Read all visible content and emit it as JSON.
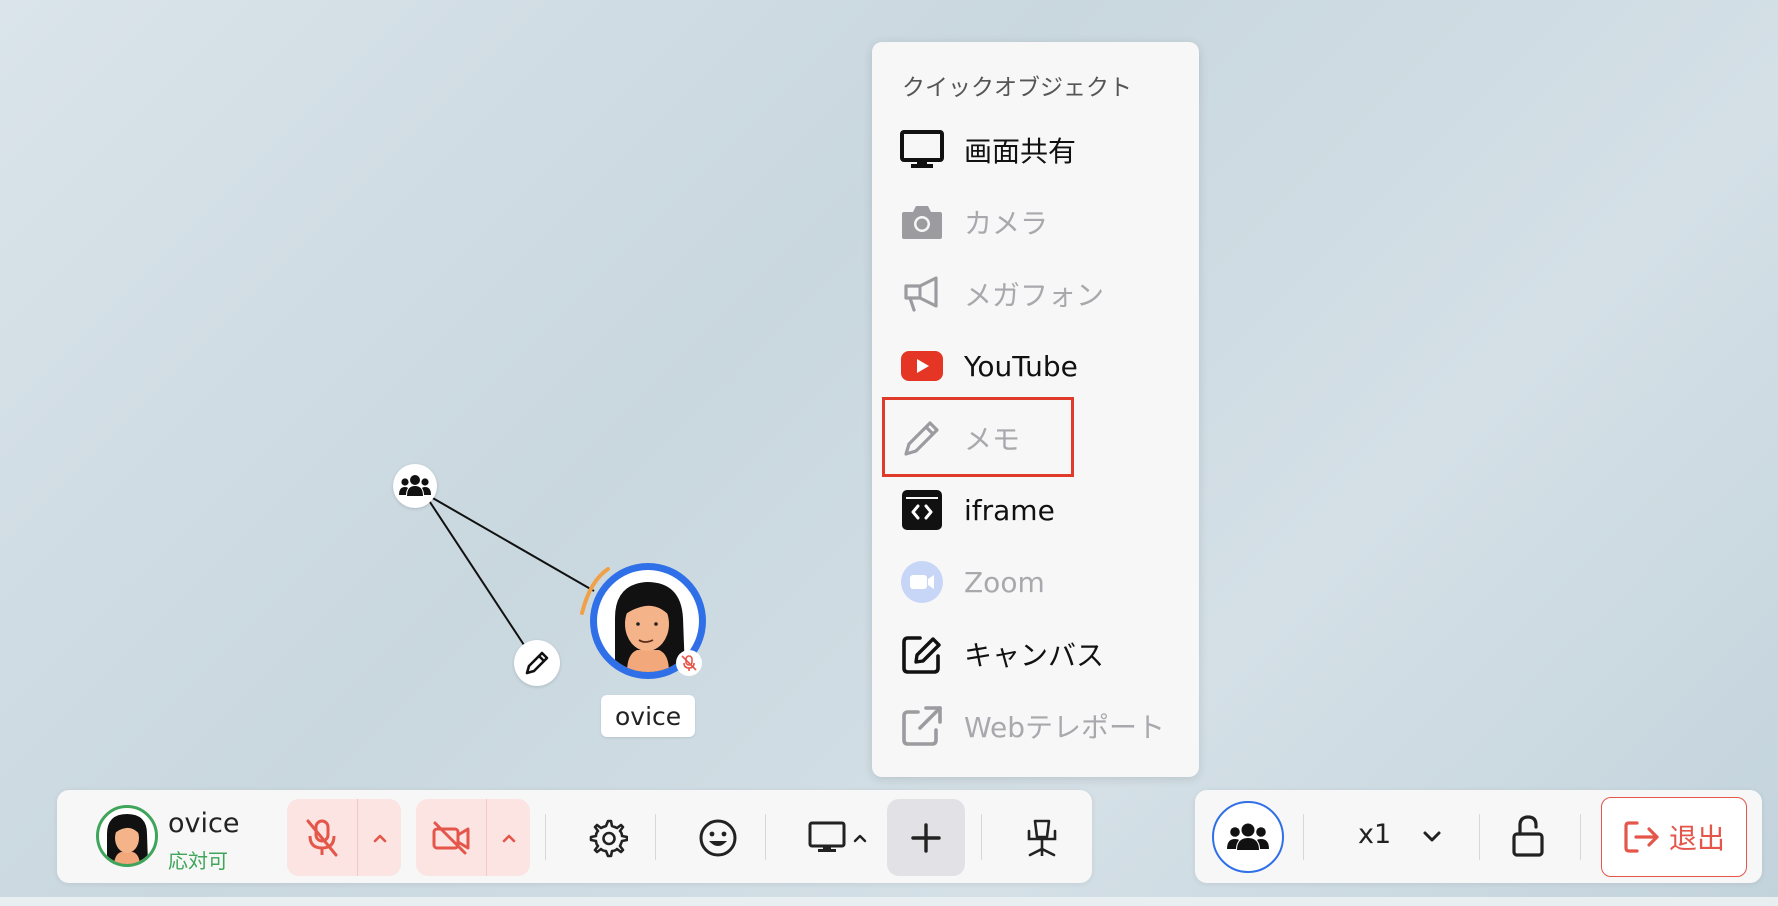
{
  "avatar": {
    "name": "ovice"
  },
  "menu": {
    "title": "クイックオブジェクト",
    "items": [
      {
        "label": "画面共有",
        "icon": "monitor-icon",
        "enabled": true
      },
      {
        "label": "カメラ",
        "icon": "camera-icon",
        "enabled": false
      },
      {
        "label": "メガフォン",
        "icon": "megaphone-icon",
        "enabled": false
      },
      {
        "label": "YouTube",
        "icon": "youtube-icon",
        "enabled": true
      },
      {
        "label": "メモ",
        "icon": "pencil-icon",
        "enabled": false,
        "highlighted": true
      },
      {
        "label": "iframe",
        "icon": "iframe-icon",
        "enabled": true
      },
      {
        "label": "Zoom",
        "icon": "zoom-icon",
        "enabled": false
      },
      {
        "label": "キャンバス",
        "icon": "canvas-edit-icon",
        "enabled": true
      },
      {
        "label": "Webテレポート",
        "icon": "external-link-icon",
        "enabled": false
      }
    ]
  },
  "toolbar": {
    "user_name": "ovice",
    "user_status": "応対可",
    "zoom_level": "x1",
    "exit_label": "退出"
  },
  "colors": {
    "accent_blue": "#2f6fe8",
    "danger_red": "#e5564a",
    "status_green": "#3fa55a",
    "youtube_red": "#e53524"
  }
}
